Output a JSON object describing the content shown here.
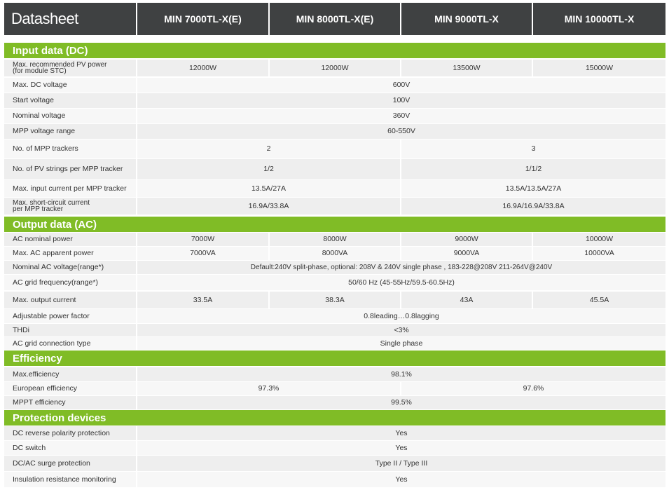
{
  "header": {
    "title": "Datasheet",
    "models": [
      "MIN 7000TL-X(E)",
      "MIN 8000TL-X(E)",
      "MIN 9000TL-X",
      "MIN 10000TL-X"
    ]
  },
  "sections": {
    "input": "Input data (DC)",
    "output": "Output data (AC)",
    "efficiency": "Efficiency",
    "protection": "Protection devices"
  },
  "rows": {
    "max_pv_power": {
      "label": "Max. recommended PV power\n(for module STC)",
      "values": [
        "12000W",
        "12000W",
        "13500W",
        "15000W"
      ]
    },
    "max_dc_voltage": {
      "label": "Max. DC voltage",
      "value": "600V"
    },
    "start_voltage": {
      "label": "Start voltage",
      "value": "100V"
    },
    "nominal_voltage": {
      "label": "Nominal voltage",
      "value": "360V"
    },
    "mpp_range": {
      "label": "MPP voltage range",
      "value": "60-550V"
    },
    "mpp_trackers": {
      "label": "No. of MPP trackers",
      "values": [
        "2",
        "3"
      ]
    },
    "pv_strings": {
      "label": "No. of PV strings per MPP tracker",
      "values": [
        "1/2",
        "1/1/2"
      ]
    },
    "max_input_current": {
      "label": "Max. input current per MPP tracker",
      "values": [
        "13.5A/27A",
        "13.5A/13.5A/27A"
      ]
    },
    "max_short_circuit": {
      "label": "Max. short-circuit current\nper MPP tracker",
      "values": [
        "16.9A/33.8A",
        "16.9A/16.9A/33.8A"
      ]
    },
    "ac_nominal_power": {
      "label": "AC nominal power",
      "values": [
        "7000W",
        "8000W",
        "9000W",
        "10000W"
      ]
    },
    "ac_apparent_power": {
      "label": "Max. AC apparent power",
      "values": [
        "7000VA",
        "8000VA",
        "9000VA",
        "10000VA"
      ]
    },
    "nominal_ac_voltage": {
      "label": "Nominal AC voltage(range*)",
      "value": "Default:240V split-phase, optional: 208V & 240V single phase , 183-228@208V 211-264V@240V"
    },
    "ac_grid_freq": {
      "label": "AC grid frequency(range*)",
      "value": "50/60 Hz (45-55Hz/59.5-60.5Hz)"
    },
    "max_output_current": {
      "label": "Max. output current",
      "values": [
        "33.5A",
        "38.3A",
        "43A",
        "45.5A"
      ]
    },
    "power_factor": {
      "label": "Adjustable power factor",
      "value": "0.8leading…0.8lagging"
    },
    "thdi": {
      "label": "THDi",
      "value": "<3%"
    },
    "grid_connection": {
      "label": "AC grid connection type",
      "value": "Single phase"
    },
    "max_efficiency": {
      "label": "Max.efficiency",
      "value": "98.1%"
    },
    "euro_efficiency": {
      "label": "European efficiency",
      "values": [
        "97.3%",
        "97.6%"
      ]
    },
    "mppt_efficiency": {
      "label": "MPPT efficiency",
      "value": "99.5%"
    },
    "dc_reverse": {
      "label": "DC reverse polarity protection",
      "value": "Yes"
    },
    "dc_switch": {
      "label": "DC switch",
      "value": "Yes"
    },
    "surge_protection": {
      "label": "DC/AC surge protection",
      "value": "Type II / Type III"
    },
    "insulation": {
      "label": "Insulation resistance monitoring",
      "value": "Yes"
    }
  },
  "colors": {
    "header_bg": "#3f4142",
    "section_bg": "#80bc26",
    "row_bg": "#eeeeee"
  }
}
